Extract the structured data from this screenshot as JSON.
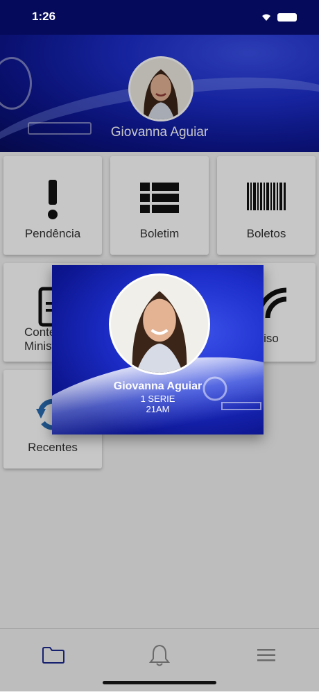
{
  "status_bar": {
    "time": "1:26"
  },
  "profile": {
    "name": "Giovanna Aguiar"
  },
  "menu": {
    "pendencia": "Pendência",
    "boletim": "Boletim",
    "boletos": "Boletos",
    "conteudo_line1": "Conte",
    "conteudo_line2": "Minist",
    "aviso": "iso",
    "recentes": "Recentes"
  },
  "modal": {
    "name": "Giovanna Aguiar",
    "serie": "1 SERIE",
    "turma": "21AM"
  },
  "tabbar": {
    "items": [
      "folder-icon",
      "bell-icon",
      "menu-icon"
    ]
  },
  "colors": {
    "header_blue": "#0c158e",
    "accent_blue": "#1d2ecb",
    "icon_blue": "#2a6fb5"
  }
}
